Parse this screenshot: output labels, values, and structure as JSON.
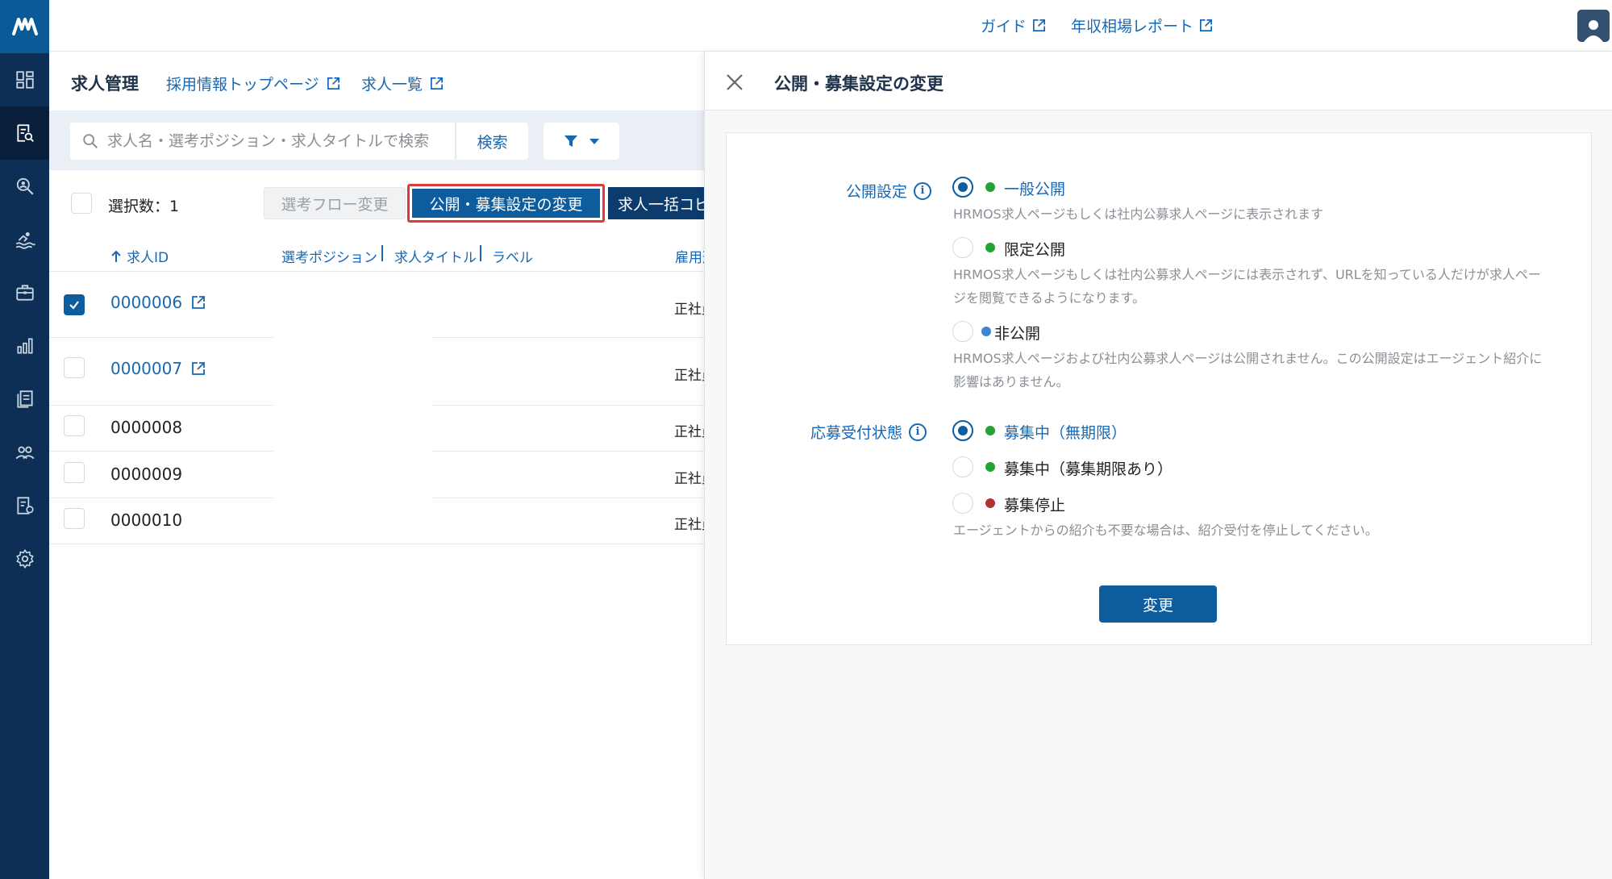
{
  "topbar": {
    "guide_label": "ガイド",
    "salary_report_label": "年収相場レポート"
  },
  "header": {
    "title": "求人管理",
    "links": [
      "採用情報トップページ",
      "求人一覧"
    ]
  },
  "search": {
    "placeholder": "求人名・選考ポジション・求人タイトルで検索",
    "button_label": "検索"
  },
  "actions": {
    "selected_count_label": "選択数：1",
    "flow_change_label": "選考フロー変更",
    "publish_change_label": "公開・募集設定の変更",
    "bulk_label": "求人一括コピー"
  },
  "table": {
    "col_id": "求人ID",
    "col_position": "選考ポジション",
    "col_title": "求人タイトル",
    "col_label": "ラベル",
    "col_employment": "雇用形態",
    "rows": [
      {
        "id": "0000006",
        "employment": "正社員",
        "checked": true,
        "link": true
      },
      {
        "id": "0000007",
        "employment": "正社員",
        "checked": false,
        "link": true
      },
      {
        "id": "0000008",
        "employment": "正社員",
        "checked": false,
        "link": false
      },
      {
        "id": "0000009",
        "employment": "正社員",
        "checked": false,
        "link": false
      },
      {
        "id": "0000010",
        "employment": "正社員",
        "checked": false,
        "link": false
      }
    ]
  },
  "panel": {
    "title": "公開・募集設定の変更",
    "publish": {
      "label": "公開設定",
      "options": [
        {
          "label": "一般公開",
          "desc": "HRMOS求人ページもしくは社内公募求人ページに表示されます",
          "selected": true,
          "dot": "#22a335"
        },
        {
          "label": "限定公開",
          "desc": "HRMOS求人ページもしくは社内公募求人ページには表示されず、URLを知っている人だけが求人ページを閲覧できるようになります。",
          "selected": false,
          "dot": "#22a335"
        },
        {
          "label": "非公開",
          "desc": "HRMOS求人ページおよび社内公募求人ページは公開されません。この公開設定はエージェント紹介に影響はありません。",
          "selected": false,
          "dot": "#3b87d6"
        }
      ]
    },
    "recruit": {
      "label": "応募受付状態",
      "options": [
        {
          "label": "募集中（無期限）",
          "selected": true,
          "dot": "#22a335"
        },
        {
          "label": "募集中（募集期限あり）",
          "selected": false,
          "dot": "#22a335"
        },
        {
          "label": "募集停止",
          "selected": false,
          "dot": "#b2322f"
        }
      ],
      "note": "エージェントからの紹介も不要な場合は、紹介受付を停止してください。"
    },
    "submit_label": "変更"
  },
  "colors": {
    "sidebar": "#0d2f56",
    "primary": "#0d5c9e",
    "link": "#1668b5",
    "highlight": "#e0393b"
  }
}
